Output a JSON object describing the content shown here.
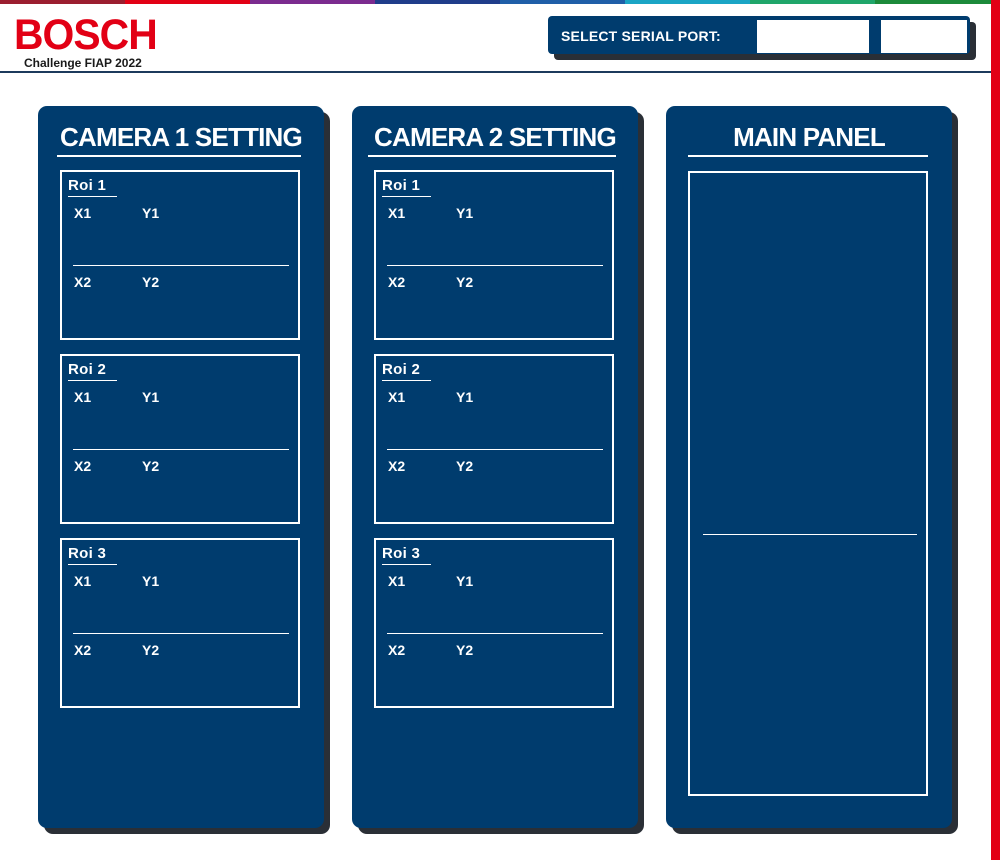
{
  "brand": {
    "logo_text": "BOSCH",
    "subtitle": "Challenge FIAP 2022",
    "color": "#e20015",
    "stripe_colors": [
      "#9b1e2f",
      "#e20015",
      "#7b2b8f",
      "#1f3d8a",
      "#1f5fa8",
      "#1aa5c5",
      "#20a66a",
      "#1c8a3a"
    ]
  },
  "header": {
    "serial_label": "SELECT SERIAL PORT:",
    "serial_port_value": "",
    "connect_button_label": ""
  },
  "panels": {
    "camera1": {
      "title": "CAMERA 1 SETTING",
      "rois": [
        {
          "label": "Roi  1",
          "x1": "X1",
          "y1": "Y1",
          "x2": "X2",
          "y2": "Y2"
        },
        {
          "label": "Roi  2",
          "x1": "X1",
          "y1": "Y1",
          "x2": "X2",
          "y2": "Y2"
        },
        {
          "label": "Roi  3",
          "x1": "X1",
          "y1": "Y1",
          "x2": "X2",
          "y2": "Y2"
        }
      ]
    },
    "camera2": {
      "title": "CAMERA 2 SETTING",
      "rois": [
        {
          "label": "Roi  1",
          "x1": "X1",
          "y1": "Y1",
          "x2": "X2",
          "y2": "Y2"
        },
        {
          "label": "Roi  2",
          "x1": "X1",
          "y1": "Y1",
          "x2": "X2",
          "y2": "Y2"
        },
        {
          "label": "Roi  3",
          "x1": "X1",
          "y1": "Y1",
          "x2": "X2",
          "y2": "Y2"
        }
      ]
    },
    "main": {
      "title": "MAIN PANEL"
    }
  },
  "colors": {
    "panel_bg": "#003c6e",
    "shadow": "#2a2f36",
    "accent_red": "#e20015"
  }
}
